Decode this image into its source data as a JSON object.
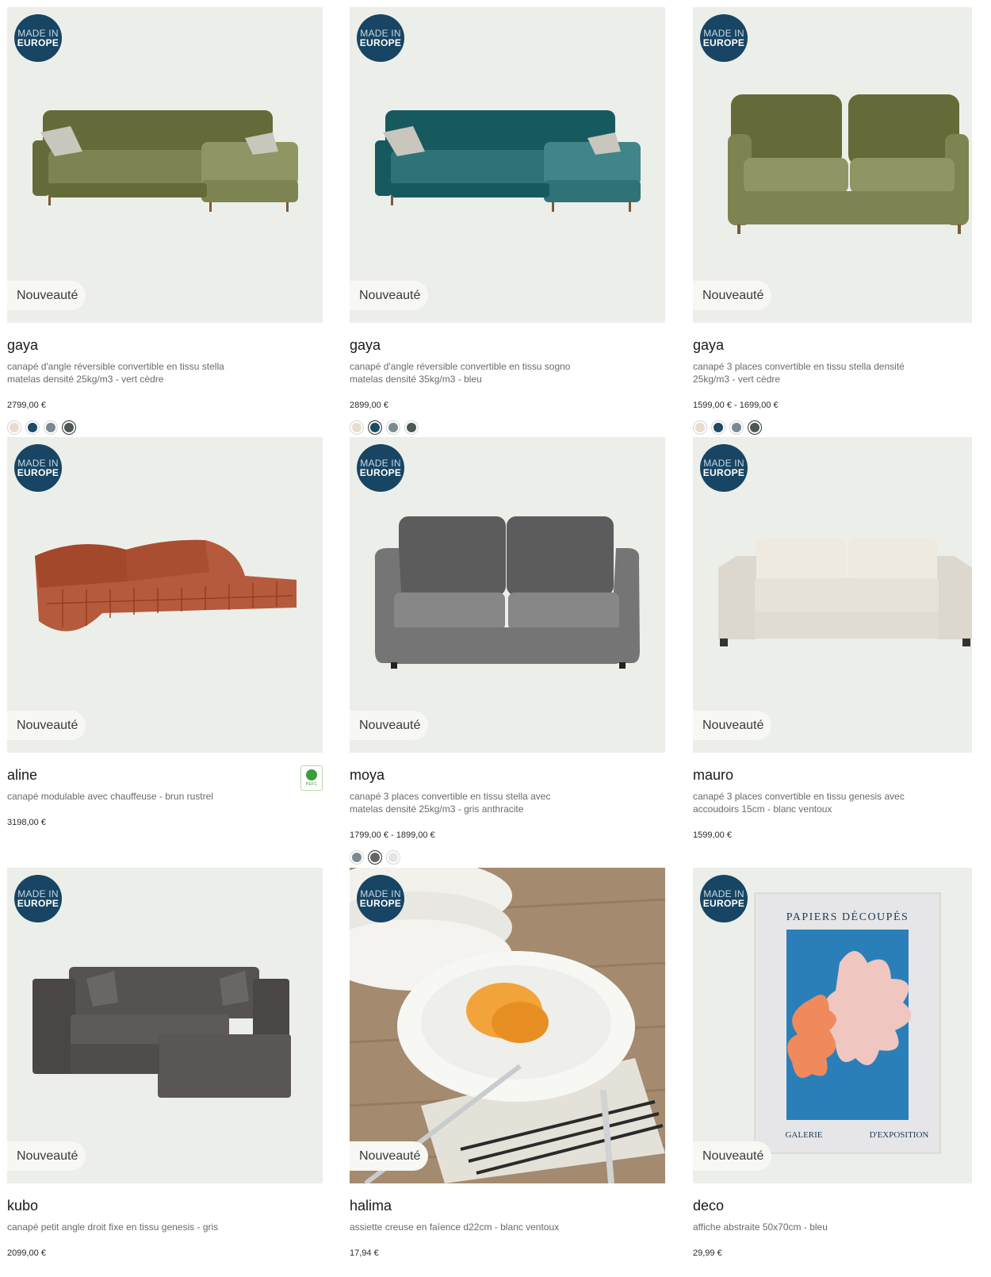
{
  "badges": {
    "europe_line1": "MADE IN",
    "europe_line2": "EUROPE",
    "new_label": "Nouveauté"
  },
  "products": [
    {
      "name": "gaya",
      "desc": "canapé d'angle réversible convertible en tissu stella matelas densité 25kg/m3 - vert cèdre",
      "price": "2799,00 €",
      "swatches": [
        "#e8dccb",
        "#1e4a66",
        "#7a8a90",
        "#4e5750"
      ],
      "selected": 3,
      "color": "#7e8451"
    },
    {
      "name": "gaya",
      "desc": "canapé d'angle réversible convertible en tissu sogno matelas densité 35kg/m3 - bleu",
      "price": "2899,00 €",
      "swatches": [
        "#e8dccb",
        "#1e4a66",
        "#7a8a90",
        "#4e5750"
      ],
      "selected": 1,
      "color": "#2f7378"
    },
    {
      "name": "gaya",
      "desc": "canapé 3 places convertible en tissu stella densité 25kg/m3 - vert cèdre",
      "price": "1599,00 € - 1699,00 €",
      "swatches": [
        "#e8dccb",
        "#1e4a66",
        "#7a8a90",
        "#4e5750"
      ],
      "selected": 3,
      "color": "#7e8451"
    },
    {
      "name": "aline",
      "desc": "canapé modulable avec chauffeuse - brun rustrel",
      "price": "3198,00 €",
      "swatches": [],
      "selected": -1,
      "color": "#b55a3c",
      "pefc": "PEFC"
    },
    {
      "name": "moya",
      "desc": "canapé 3 places convertible en tissu stella avec matelas densité 25kg/m3 - gris anthracite",
      "price": "1799,00 € - 1899,00 €",
      "swatches": [
        "#7a8a90",
        "#666666",
        "#e2e4e6"
      ],
      "selected": 1,
      "color": "#757575"
    },
    {
      "name": "mauro",
      "desc": "canapé 3 places convertible en tissu genesis avec accoudoirs 15cm - blanc ventoux",
      "price": "1599,00 €",
      "swatches": [],
      "selected": -1,
      "color": "#e6e2d8"
    },
    {
      "name": "kubo",
      "desc": "canapé petit angle droit fixe en tissu genesis - gris",
      "price": "2099,00 €",
      "swatches": [],
      "selected": -1,
      "color": "#5e5a58"
    },
    {
      "name": "halima",
      "desc": "assiette creuse en faïence d22cm - blanc ventoux",
      "price": "17,94 €",
      "swatches": [],
      "selected": -1,
      "color": "#ffffff"
    },
    {
      "name": "deco",
      "desc": "affiche abstraite 50x70cm - bleu",
      "price": "29,99 €",
      "swatches": [],
      "selected": -1,
      "color": "#2a7fb8",
      "poster": {
        "title": "PAPIERS  DÉCOUPÉS",
        "footer_left": "GALERIE",
        "footer_right": "D'EXPOSITION"
      }
    }
  ]
}
